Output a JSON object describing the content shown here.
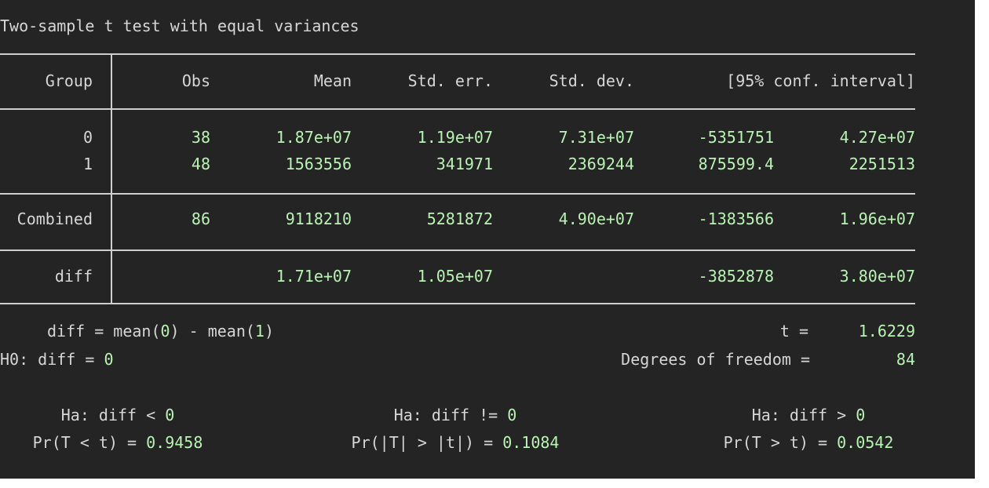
{
  "title": "Two-sample t test with equal variances",
  "headers": [
    "Group",
    "Obs",
    "Mean",
    "Std. err.",
    "Std. dev.",
    "[95% conf. interval]"
  ],
  "rows": [
    {
      "group": "0",
      "obs": "38",
      "mean": "1.87e+07",
      "se": "1.19e+07",
      "sd": "7.31e+07",
      "ci_low": "-5351751",
      "ci_high": "4.27e+07"
    },
    {
      "group": "1",
      "obs": "48",
      "mean": "1563556",
      "se": "341971",
      "sd": "2369244",
      "ci_low": "875599.4",
      "ci_high": "2251513"
    }
  ],
  "combined": {
    "group": "Combined",
    "obs": "86",
    "mean": "9118210",
    "se": "5281872",
    "sd": "4.90e+07",
    "ci_low": "-1383566",
    "ci_high": "1.96e+07"
  },
  "diff": {
    "group": "diff",
    "mean": "1.71e+07",
    "se": "1.05e+07",
    "ci_low": "-3852878",
    "ci_high": "3.80e+07"
  },
  "stats": {
    "diff_def_prefix": "diff = mean(",
    "diff_def_g0": "0",
    "diff_def_mid": ") - mean(",
    "diff_def_g1": "1",
    "diff_def_suffix": ")",
    "t_label": "t =",
    "t_value": "1.6229",
    "h0_prefix": "H0: diff = ",
    "h0_value": "0",
    "df_label": "Degrees of freedom =",
    "df_value": "84"
  },
  "tests": {
    "left": {
      "ha_prefix": "Ha: diff < ",
      "ha_value": "0",
      "pr_label": "Pr(T < t) = ",
      "pr_value": "0.9458"
    },
    "mid": {
      "ha_prefix": "Ha: diff != ",
      "ha_value": "0",
      "pr_label": "Pr(|T| > |t|) = ",
      "pr_value": "0.1084"
    },
    "right": {
      "ha_prefix": "Ha: diff > ",
      "ha_value": "0",
      "pr_label": "Pr(T > t) = ",
      "pr_value": "0.0542"
    }
  },
  "colors": {
    "background": "#242424",
    "text": "#d6d6d6",
    "value": "#b9f3b3",
    "rule": "#cfcfcf"
  }
}
